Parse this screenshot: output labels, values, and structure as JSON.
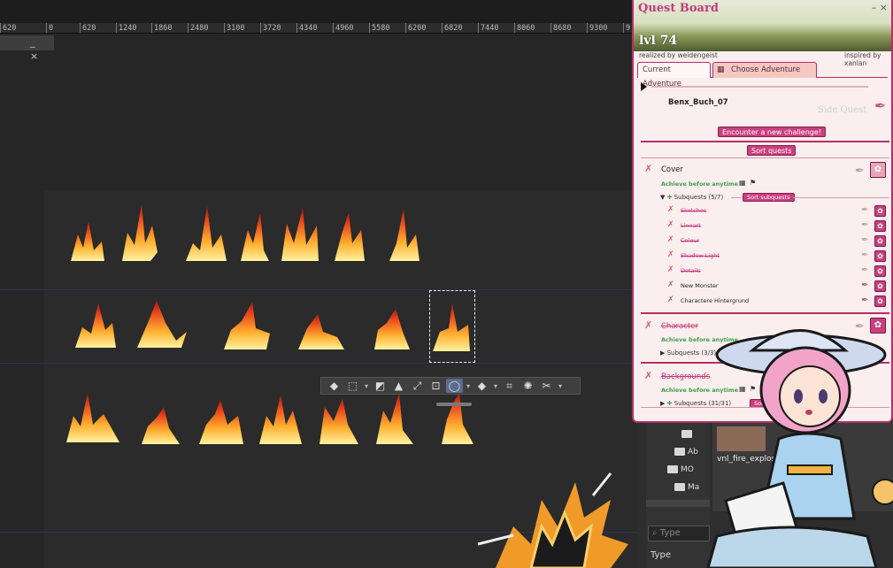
{
  "ruler": {
    "ticks": [
      "620",
      "0",
      "620",
      "1240",
      "1860",
      "2480",
      "3100",
      "3720",
      "4340",
      "4960",
      "5580",
      "6200",
      "6820",
      "7440",
      "8060",
      "8680",
      "9300",
      "9"
    ]
  },
  "mini_window": {
    "controls": "_ ×"
  },
  "toolbar": {
    "tools": [
      "fill-icon",
      "rect-select-icon",
      "gradient-icon",
      "stamp-icon",
      "transform-icon",
      "grid-select-icon",
      "lasso-icon",
      "fill-alt-icon",
      "crop-icon",
      "magic-wand-icon",
      "cut-icon"
    ]
  },
  "quest_board": {
    "title": "Quest Board",
    "level": "lvl 74",
    "credit_left": "realized by weidengeist",
    "credit_right": "inspired by xanlan",
    "window_controls": "– ×",
    "tabs": {
      "current": "Current Adventure",
      "choose": "Choose Adventure"
    },
    "project_name": "Benx_Buch_07",
    "side_quest": "Side Quest",
    "new_challenge_label": "Encounter a new challenge!",
    "sort_quests_label": "Sort quests",
    "quests": [
      {
        "title": "Cover",
        "achieve": "Achieve before anytime",
        "subquests_label": "Subquests (5/7)",
        "sort_sub_label": "Sort subquests",
        "subquests": [
          {
            "title": "Sketches",
            "done": true
          },
          {
            "title": "Lineart",
            "done": true
          },
          {
            "title": "Colour",
            "done": true
          },
          {
            "title": "Shadow Light",
            "done": true
          },
          {
            "title": "Details",
            "done": true
          },
          {
            "title": "New Monster",
            "done": false
          },
          {
            "title": "Charactere Hintergrund",
            "done": false
          }
        ]
      },
      {
        "title": "Character",
        "achieve": "Achieve before anytime",
        "subquests_label": "Subquests (3/3)"
      },
      {
        "title": "Backgrounds",
        "achieve": "Achieve before anytime",
        "subquests_label": "Subquests (31/31)",
        "sort_sub_label": "Sort"
      }
    ]
  },
  "file_browser": {
    "folders": [
      "Ab",
      "MO",
      "Ma"
    ],
    "thumb_label": "vnl_fire_explosio",
    "search_placeholder": "Type",
    "type_label": "Type"
  },
  "colors": {
    "accent": "#c9407e",
    "board_bg": "#fbeeee",
    "canvas": "#2a2b2a"
  }
}
